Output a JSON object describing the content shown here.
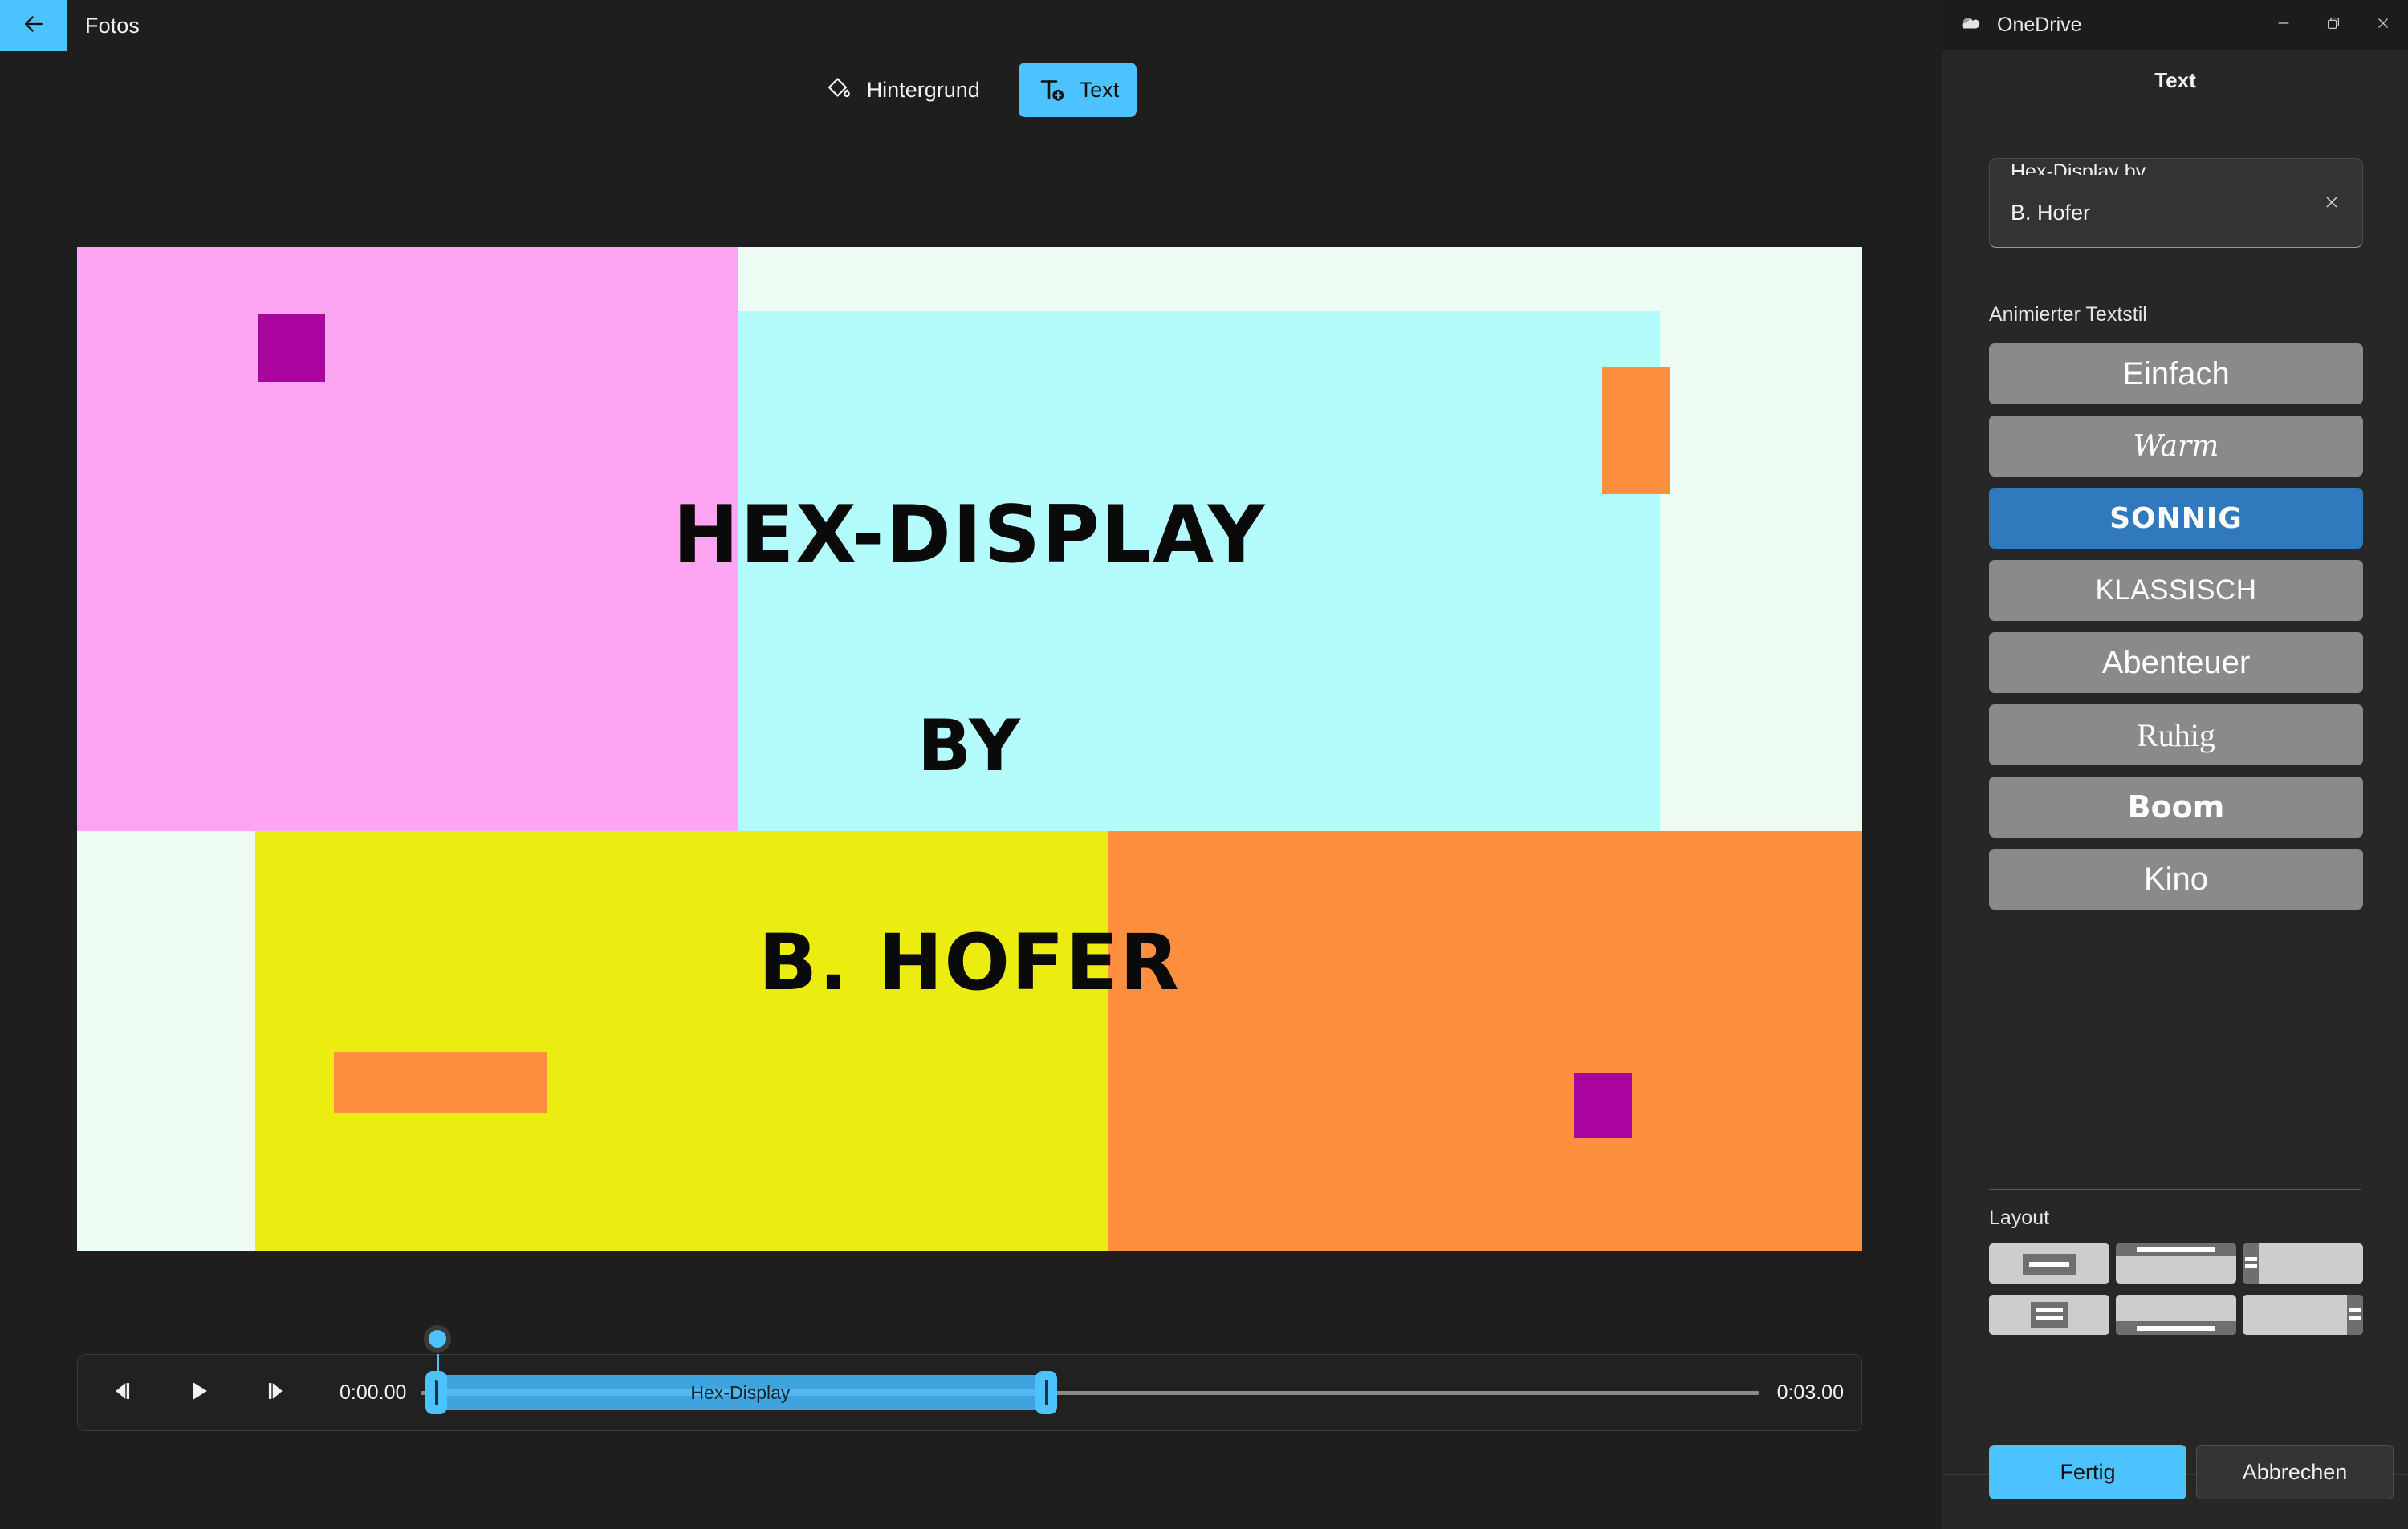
{
  "window": {
    "back_icon": "arrow-left-icon",
    "app_title": "Fotos"
  },
  "toolbar": {
    "items": [
      {
        "label": "Hintergrund",
        "icon": "paint-bucket-icon",
        "active": false
      },
      {
        "label": "Text",
        "icon": "text-add-icon",
        "active": true
      }
    ]
  },
  "canvas": {
    "title_lines": [
      "HEX-DISPLAY",
      "BY",
      "B. HOFER"
    ],
    "colors": {
      "background": "#edfbf3",
      "pink": "#fda5f2",
      "cyan": "#b4fbfb",
      "yellow": "#ebec10",
      "orange": "#fd8f3e",
      "magenta": "#a9059e",
      "text": "#0a0a0a"
    }
  },
  "transport": {
    "prev_frame_icon": "previous-frame-icon",
    "play_icon": "play-icon",
    "next_frame_icon": "next-frame-icon",
    "current_time": "0:00.00",
    "total_time": "0:03.00",
    "clip_label": "Hex-Display",
    "playhead_position_percent": 0,
    "clip_start_percent": 0,
    "clip_end_percent": 42.5
  },
  "panel": {
    "titlebar": {
      "app_name": "OneDrive",
      "cloud_icon": "onedrive-cloud-icon",
      "minimize_icon": "minimize-icon",
      "restore_icon": "restore-icon",
      "close_icon": "close-icon"
    },
    "header": "Text",
    "text_field": {
      "line_clipped": "Hex-Display by",
      "value": "B. Hofer",
      "clear_icon": "close-icon"
    },
    "style_section_label": "Animierter Textstil",
    "styles": [
      {
        "label": "Einfach",
        "class": "s-einfach",
        "selected": false
      },
      {
        "label": "Warm",
        "class": "s-warm",
        "selected": false
      },
      {
        "label": "SONNIG",
        "class": "s-sonnig",
        "selected": true
      },
      {
        "label": "KLASSISCH",
        "class": "s-klassisch",
        "selected": false
      },
      {
        "label": "Abenteuer",
        "class": "s-abenteuer",
        "selected": false
      },
      {
        "label": "Ruhig",
        "class": "s-ruhig",
        "selected": false
      },
      {
        "label": "Boom",
        "class": "s-boom",
        "selected": false
      },
      {
        "label": "Kino",
        "class": "s-kino",
        "selected": false
      }
    ],
    "layout_section_label": "Layout",
    "layouts": [
      {
        "name": "layout-center-single"
      },
      {
        "name": "layout-top-band"
      },
      {
        "name": "layout-left-band"
      },
      {
        "name": "layout-center-double"
      },
      {
        "name": "layout-bottom-band"
      },
      {
        "name": "layout-right-band"
      }
    ],
    "actions": {
      "done_label": "Fertig",
      "cancel_label": "Abbrechen"
    }
  },
  "theme": {
    "accent": "#4cc2ff",
    "selected_style": "#3079bc",
    "panel_bg": "#272727",
    "editor_bg": "#1e1e1e"
  }
}
